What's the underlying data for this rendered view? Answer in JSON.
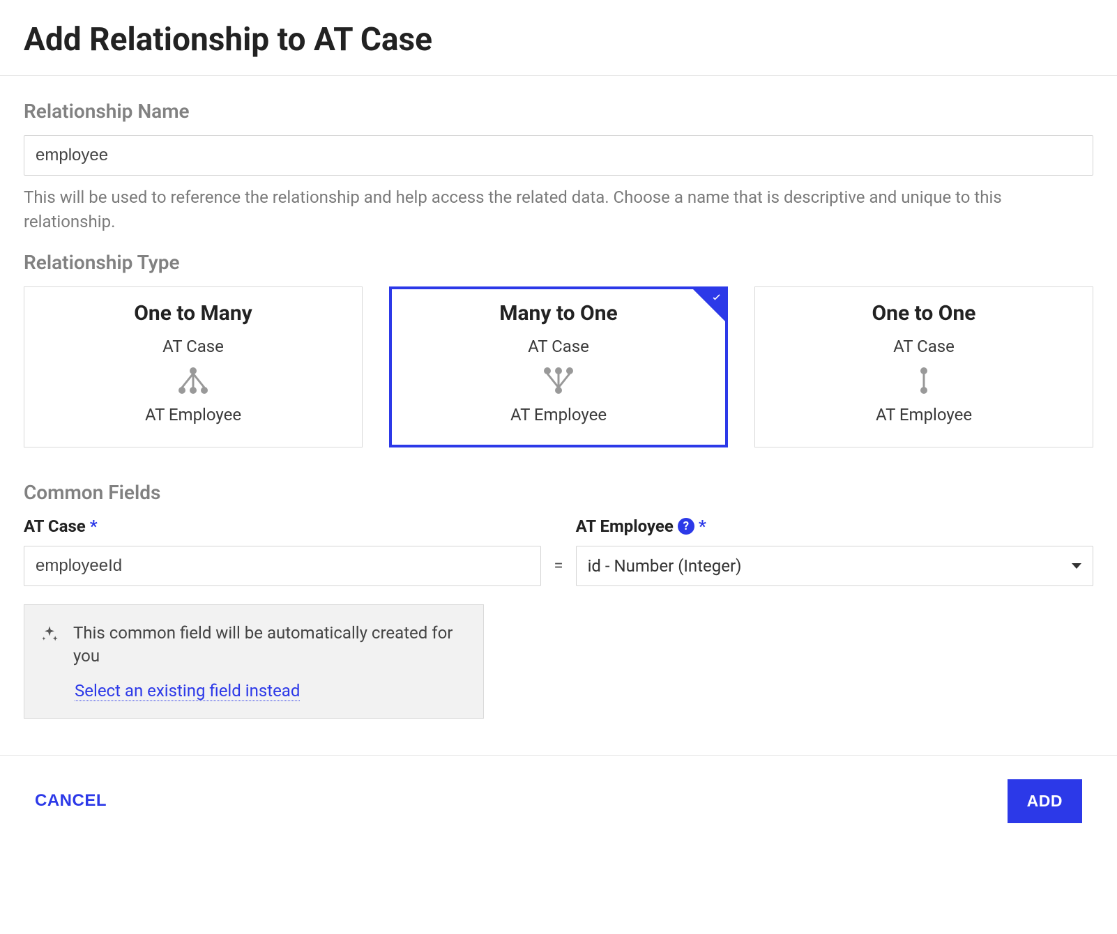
{
  "title": "Add Relationship to AT Case",
  "relationshipName": {
    "label": "Relationship Name",
    "value": "employee",
    "helper": "This will be used to reference the relationship and help access the related data. Choose a name that is descriptive and unique to this relationship."
  },
  "relationshipType": {
    "label": "Relationship Type",
    "entityTop": "AT Case",
    "entityBottom": "AT Employee",
    "options": [
      {
        "title": "One to Many",
        "selected": false
      },
      {
        "title": "Many to One",
        "selected": true
      },
      {
        "title": "One to One",
        "selected": false
      }
    ]
  },
  "commonFields": {
    "label": "Common Fields",
    "left": {
      "label": "AT Case",
      "value": "employeeId"
    },
    "equals": "=",
    "right": {
      "label": "AT Employee",
      "value": "id - Number (Integer)"
    },
    "info": {
      "text": "This common field will be automatically created for you",
      "link": "Select an existing field instead"
    }
  },
  "footer": {
    "cancel": "CANCEL",
    "add": "ADD"
  }
}
